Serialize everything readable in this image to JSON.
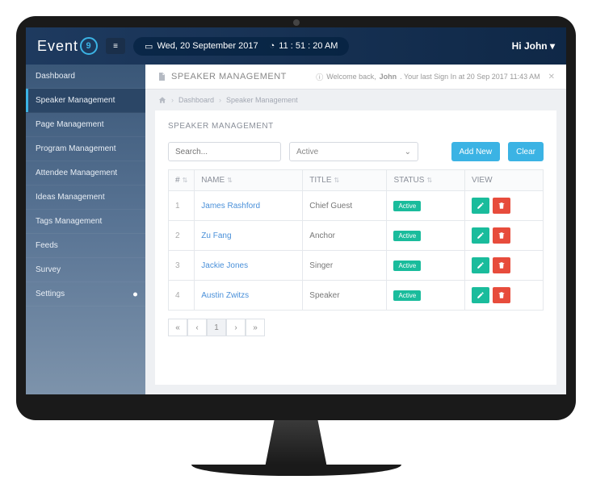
{
  "logo": {
    "text": "Event",
    "badge": "9"
  },
  "topbar": {
    "date": "Wed, 20 September 2017",
    "time": "11 : 51 : 20 AM",
    "greeting": "Hi John"
  },
  "sidebar": {
    "items": [
      {
        "label": "Dashboard"
      },
      {
        "label": "Speaker Management",
        "active": true
      },
      {
        "label": "Page Management"
      },
      {
        "label": "Program Management"
      },
      {
        "label": "Attendee Management"
      },
      {
        "label": "Ideas Management"
      },
      {
        "label": "Tags Management"
      },
      {
        "label": "Feeds"
      },
      {
        "label": "Survey"
      },
      {
        "label": "Settings",
        "dot": true
      }
    ]
  },
  "page": {
    "header_title": "SPEAKER MANAGEMENT",
    "welcome_prefix": "Welcome back,",
    "welcome_name": "John",
    "welcome_suffix": ". Your last Sign In at 20 Sep 2017 11:43 AM",
    "crumbs": [
      "Dashboard",
      "Speaker Management"
    ],
    "panel_title": "SPEAKER MANAGEMENT"
  },
  "filters": {
    "search_placeholder": "Search...",
    "status_value": "Active",
    "add_label": "Add New",
    "clear_label": "Clear"
  },
  "table": {
    "cols": {
      "idx": "#",
      "name": "NAME",
      "title": "TITLE",
      "status": "STATUS",
      "view": "VIEW"
    },
    "rows": [
      {
        "idx": "1",
        "name": "James Rashford",
        "title": "Chief Guest",
        "status": "Active"
      },
      {
        "idx": "2",
        "name": "Zu Fang",
        "title": "Anchor",
        "status": "Active"
      },
      {
        "idx": "3",
        "name": "Jackie Jones",
        "title": "Singer",
        "status": "Active"
      },
      {
        "idx": "4",
        "name": "Austin Zwitzs",
        "title": "Speaker",
        "status": "Active"
      }
    ]
  },
  "pager": {
    "first": "«",
    "prev": "‹",
    "current": "1",
    "next": "›",
    "last": "»"
  }
}
